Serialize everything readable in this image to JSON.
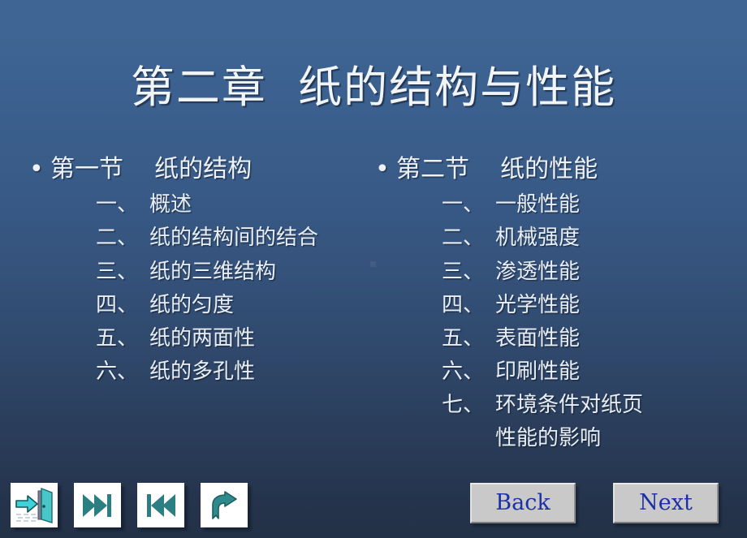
{
  "slide": {
    "title": "第二章  纸的结构与性能",
    "background": {
      "top_color": "#3e6593",
      "bottom_color": "#233147",
      "text_color": "#eef2f7"
    },
    "columns": [
      {
        "bullet": "•",
        "section_title": "第一节    纸的结构",
        "items": [
          {
            "num": "一、",
            "text": "概述"
          },
          {
            "num": "二、",
            "text": "纸的结构间的结合"
          },
          {
            "num": "三、",
            "text": "纸的三维结构"
          },
          {
            "num": "四、",
            "text": "纸的匀度"
          },
          {
            "num": "五、",
            "text": "纸的两面性"
          },
          {
            "num": "六、",
            "text": "纸的多孔性"
          }
        ]
      },
      {
        "bullet": "•",
        "section_title": "第二节    纸的性能",
        "items": [
          {
            "num": "一、",
            "text": "一般性能"
          },
          {
            "num": "二、",
            "text": "机械强度"
          },
          {
            "num": "三、",
            "text": "渗透性能"
          },
          {
            "num": "四、",
            "text": "光学性能"
          },
          {
            "num": "五、",
            "text": "表面性能"
          },
          {
            "num": "六、",
            "text": "印刷性能"
          },
          {
            "num": "七、",
            "text": "环境条件对纸页\n性能的影响"
          }
        ]
      }
    ],
    "icon_buttons": [
      {
        "name": "exit-icon",
        "title": "Exit"
      },
      {
        "name": "skip-forward-icon",
        "title": "Last slide"
      },
      {
        "name": "skip-backward-icon",
        "title": "First slide"
      },
      {
        "name": "return-arrow-icon",
        "title": "Return"
      }
    ],
    "nav_buttons": [
      {
        "name": "back-button",
        "label": "Back"
      },
      {
        "name": "next-button",
        "label": "Next"
      }
    ],
    "accent_colors": {
      "icon_teal": "#2b7f82",
      "button_face": "#c9c9c9",
      "button_text": "#1d2fa8"
    }
  }
}
